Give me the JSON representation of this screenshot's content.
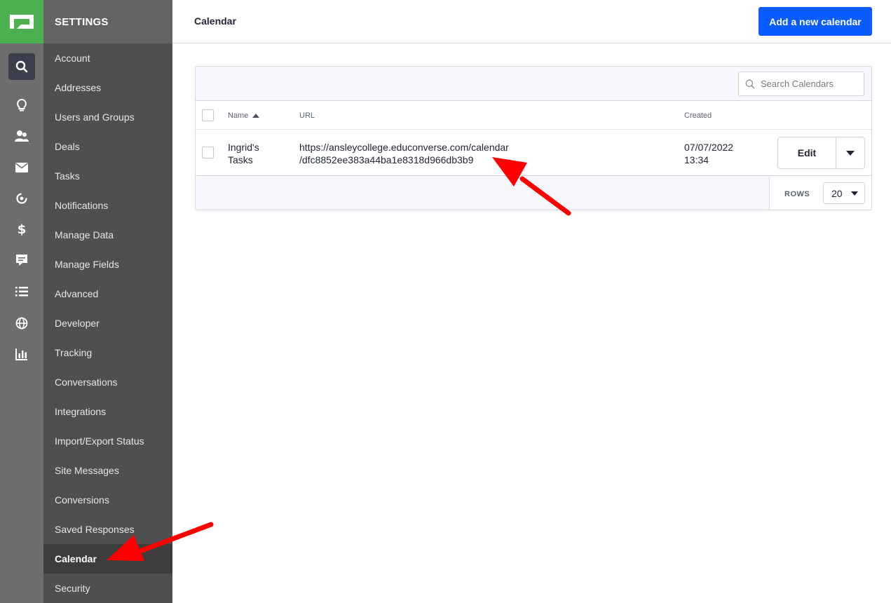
{
  "sidebar": {
    "title": "SETTINGS",
    "items": [
      {
        "label": "Account"
      },
      {
        "label": "Addresses"
      },
      {
        "label": "Users and Groups"
      },
      {
        "label": "Deals"
      },
      {
        "label": "Tasks"
      },
      {
        "label": "Notifications"
      },
      {
        "label": "Manage Data"
      },
      {
        "label": "Manage Fields"
      },
      {
        "label": "Advanced"
      },
      {
        "label": "Developer"
      },
      {
        "label": "Tracking"
      },
      {
        "label": "Conversations"
      },
      {
        "label": "Integrations"
      },
      {
        "label": "Import/Export Status"
      },
      {
        "label": "Site Messages"
      },
      {
        "label": "Conversions"
      },
      {
        "label": "Saved Responses"
      },
      {
        "label": "Calendar",
        "active": true
      },
      {
        "label": "Security"
      }
    ]
  },
  "rail": {
    "icons": [
      "search-icon",
      "lightbulb-icon",
      "contacts-icon",
      "mail-icon",
      "automation-icon",
      "dollar-icon",
      "conversations-icon",
      "list-icon",
      "globe-icon",
      "reports-icon"
    ]
  },
  "header": {
    "title": "Calendar",
    "add_button_label": "Add a new calendar"
  },
  "table": {
    "search_placeholder": "Search Calendars",
    "columns": {
      "name": "Name",
      "url": "URL",
      "created": "Created"
    },
    "rows": [
      {
        "name_line1": "Ingrid's",
        "name_line2": "Tasks",
        "url_line1": "https://ansleycollege.educonverse.com/calendar",
        "url_line2": "/dfc8852ee383a44ba1e8318d966db3b9",
        "created_line1": "07/07/2022",
        "created_line2": "13:34",
        "edit_label": "Edit"
      }
    ],
    "rows_label": "ROWS",
    "rows_value": "20"
  },
  "colors": {
    "accent": "#0a5cff",
    "logo": "#4caf50",
    "annotation_arrow": "#ff0000"
  }
}
